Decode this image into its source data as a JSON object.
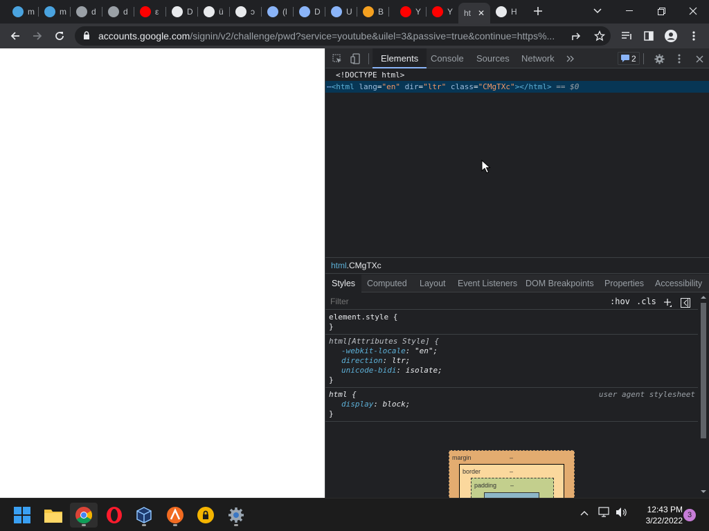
{
  "tabs": [
    {
      "label": "m",
      "icon": "edge-fish-icon",
      "color": "#4aa3df"
    },
    {
      "label": "m",
      "icon": "edge-fish-icon",
      "color": "#4aa3df"
    },
    {
      "label": "d",
      "icon": "globe-icon",
      "color": "#9aa0a6"
    },
    {
      "label": "d",
      "icon": "globe-icon",
      "color": "#9aa0a6"
    },
    {
      "label": "ε",
      "icon": "youtube-icon",
      "color": "#ff0000"
    },
    {
      "label": "D",
      "icon": "download-icon",
      "color": "#e8eaed"
    },
    {
      "label": "ü",
      "icon": "avatar-icon",
      "color": "#e8eaed"
    },
    {
      "label": "ɔ",
      "icon": "avatar-icon",
      "color": "#e8eaed"
    },
    {
      "label": "(l",
      "icon": "home-app-icon",
      "color": "#8ab4f8"
    },
    {
      "label": "D",
      "icon": "home-app-icon",
      "color": "#8ab4f8"
    },
    {
      "label": "U",
      "icon": "home-app-icon",
      "color": "#8ab4f8"
    },
    {
      "label": "B",
      "icon": "bot-icon",
      "color": "#f4a020"
    },
    {
      "label": "Y",
      "icon": "youtube-icon",
      "color": "#ff0000"
    },
    {
      "label": "Y",
      "icon": "youtube-icon",
      "color": "#ff0000"
    },
    {
      "label": "ht",
      "icon": "none",
      "color": "#35363a"
    },
    {
      "label": "H",
      "icon": "history-icon",
      "color": "#e8eaed"
    }
  ],
  "toolbar": {
    "url_host": "accounts.google.com",
    "url_rest": "/signin/v2/challenge/pwd?service=youtube&uilel=3&passive=true&continue=https%..."
  },
  "devtools": {
    "tabs": [
      "Elements",
      "Console",
      "Sources",
      "Network"
    ],
    "issues_count": "2",
    "dom": {
      "doctype": "<!DOCTYPE html>",
      "html_open": "<html",
      "attr_lang": "lang",
      "val_lang": "\"en\"",
      "attr_dir": "dir",
      "val_dir": "\"ltr\"",
      "attr_class": "class",
      "val_class": "\"CMgTXc\"",
      "html_close": "></html>",
      "eq": "==",
      "dollar0": "$0"
    },
    "breadcrumb": {
      "tag": "html",
      "cls": ".CMgTXc"
    },
    "style_tabs": [
      "Styles",
      "Computed",
      "Layout",
      "Event Listeners",
      "DOM Breakpoints",
      "Properties",
      "Accessibility"
    ],
    "filter_placeholder": "Filter",
    "hov": ":hov",
    "cls": ".cls",
    "rules": {
      "element_style": "element.style {",
      "close": "}",
      "attr_style_sel": "html[Attributes Style] {",
      "p1_name": "-webkit-locale",
      "p1_val": "\"en\";",
      "p2_name": "direction",
      "p2_val": "ltr;",
      "p3_name": "unicode-bidi",
      "p3_val": "isolate;",
      "html_sel": "html {",
      "ua_source": "user agent stylesheet",
      "p4_name": "display",
      "p4_val": "block;"
    },
    "boxmodel": {
      "margin": "margin",
      "border": "border",
      "padding": "padding",
      "dash": "–"
    }
  },
  "taskbar": {
    "time": "12:43 PM",
    "date": "3/22/2022",
    "notifications": "3"
  }
}
